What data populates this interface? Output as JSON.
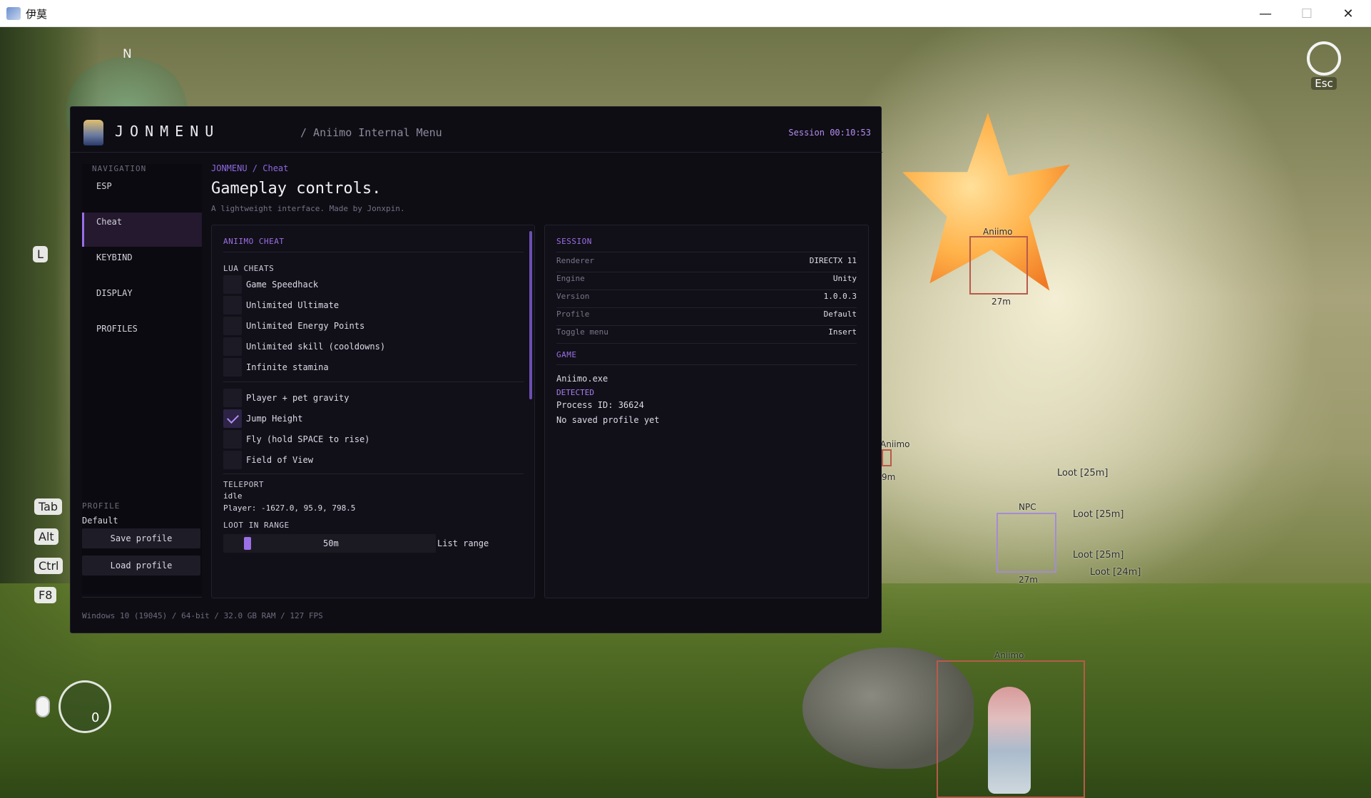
{
  "window": {
    "title": "伊莫",
    "min": "—",
    "max": "☐",
    "close": "✕"
  },
  "game": {
    "compass": "N",
    "esc_label": "Esc",
    "keys": [
      "L",
      "Tab",
      "Alt",
      "Ctrl",
      "F8"
    ],
    "emote_count": "0",
    "esp": {
      "star_label": "Aniimo",
      "star_dist": "27m",
      "side_label": "Aniimo",
      "side_dist": "9m",
      "npc_label": "NPC",
      "npc_dist": "27m",
      "char_label": "Aniimo",
      "loot": [
        "Loot [25m]",
        "Loot [25m]",
        "Loot [25m]",
        "Loot [24m]"
      ]
    }
  },
  "menu": {
    "brand": "JONMENU",
    "subtitle": "/ Aniimo Internal Menu",
    "session_clock": "Session 00:10:53",
    "nav_heading": "NAVIGATION",
    "nav": [
      "ESP",
      "Cheat",
      "KEYBIND",
      "DISPLAY",
      "PROFILES"
    ],
    "active_nav": "Cheat",
    "profile_heading": "PROFILE",
    "profile_name": "Default",
    "save_profile": "Save profile",
    "load_profile": "Load profile",
    "breadcrumb": "JONMENU / Cheat",
    "page_title": "Gameplay controls.",
    "page_subtitle": "A lightweight interface. Made by Jonxpin.",
    "cheat_card": {
      "title": "ANIIMO CHEAT",
      "lua_heading": "LUA CHEATS",
      "lua_options": [
        {
          "label": "Game Speedhack",
          "checked": false
        },
        {
          "label": "Unlimited Ultimate",
          "checked": false
        },
        {
          "label": "Unlimited Energy Points",
          "checked": false
        },
        {
          "label": "Unlimited skill (cooldowns)",
          "checked": false
        },
        {
          "label": "Infinite stamina",
          "checked": false
        }
      ],
      "movement_options": [
        {
          "label": "Player + pet gravity",
          "checked": false
        },
        {
          "label": "Jump Height",
          "checked": true
        },
        {
          "label": "Fly (hold SPACE to rise)",
          "checked": false
        },
        {
          "label": "Field of View",
          "checked": false
        }
      ],
      "teleport_heading": "TELEPORT",
      "teleport_status": "idle",
      "player_pos": "Player: -1627.0, 95.9, 798.5",
      "loot_heading": "LOOT IN RANGE",
      "loot_range": "50m",
      "loot_range_fraction": 0.1,
      "list_range": "List range"
    },
    "session_card": {
      "title": "SESSION",
      "rows": [
        {
          "key": "Renderer",
          "value": "DIRECTX 11"
        },
        {
          "key": "Engine",
          "value": "Unity"
        },
        {
          "key": "Version",
          "value": "1.0.0.3"
        },
        {
          "key": "Profile",
          "value": "Default"
        },
        {
          "key": "Toggle menu",
          "value": "Insert"
        }
      ],
      "game_heading": "GAME",
      "exe": "Aniimo.exe",
      "status": "DETECTED",
      "pid": "Process ID: 36624",
      "profile_note": "No saved profile yet"
    },
    "footer": "Windows 10 (19045) / 64-bit / 32.0 GB RAM / 127 FPS"
  },
  "colors": {
    "accent": "#9b6fe6",
    "panel": "#0e0d14",
    "esp_box": "#b85a4a",
    "npc_box": "#a58bd6"
  }
}
